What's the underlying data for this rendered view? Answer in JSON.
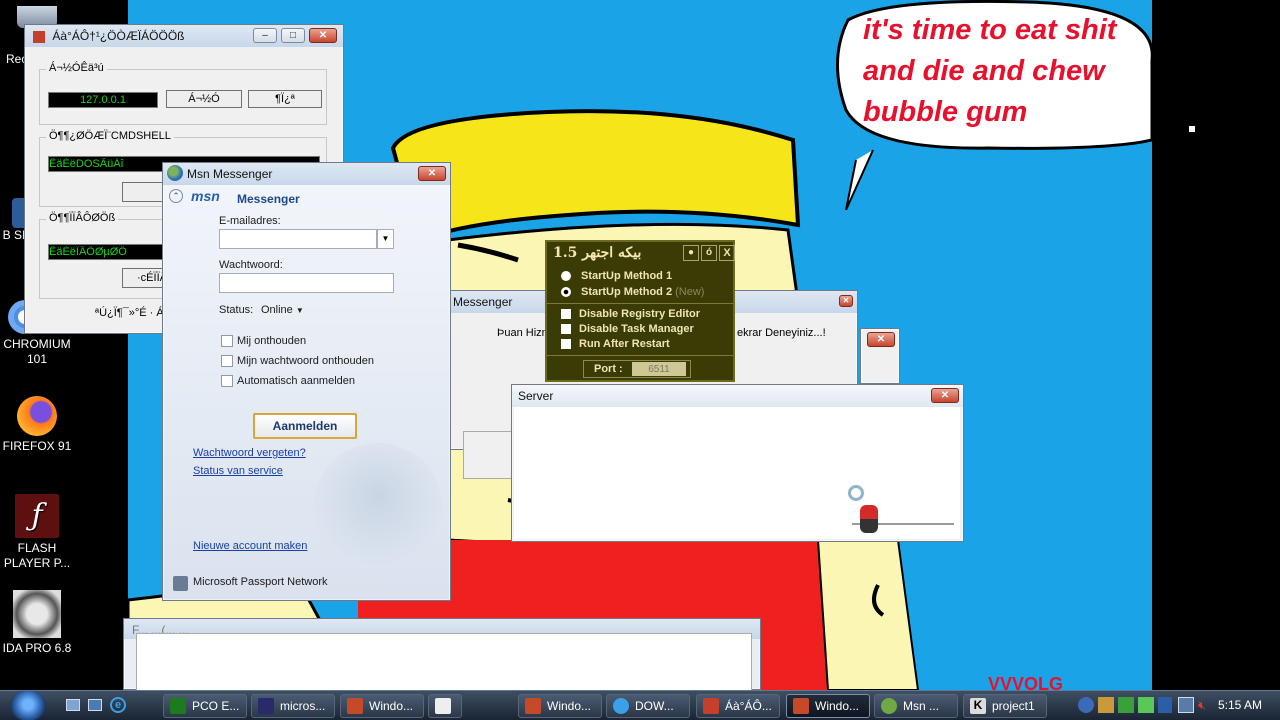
{
  "desktop": {
    "icons": [
      {
        "label": "Rec",
        "top": 0
      },
      {
        "label": "B SIM",
        "top": 0
      },
      {
        "label": "CHROMIUM 101",
        "top": 0
      },
      {
        "label": "FIREFOX 91",
        "top": 0
      },
      {
        "label": "FLASH PLAYER P...",
        "top": 0
      },
      {
        "label": "IDA PRO 6.8",
        "top": 0
      }
    ],
    "speech_bubble": [
      "it's time to eat shit",
      "and die and chew",
      "bubble gum"
    ]
  },
  "tool_window": {
    "title": "Áà°ÁÔ†¹¿ÖÒÆÏÁÖÖÖß",
    "group1_label": "Á¬½ÓÊä³ú",
    "ip_value": "127.0.0.1",
    "connect_button": "Á¬½Ó",
    "other_button": "¶Ï¿ª",
    "group2_label": "Ö¶¶¿ØÖÆÏ¨CMDSHELL",
    "cmd_value": "ÊäÈëDOSÃüÁî",
    "group3_label": "Ö¶¶ÏÏÂÔØÖß",
    "file_value": "ÊäÈëÏÂÔØµØÖ",
    "button3": "·cÉÏÏÂ",
    "footer": "ªÚ¿Ï¶¯»°É · Á"
  },
  "msn": {
    "title": "Msn Messenger",
    "brand": "msn",
    "brand_suffix": "Messenger",
    "email_label": "E-mailadres:",
    "password_label": "Wachtwoord:",
    "status_label": "Status:",
    "status_value": "Online",
    "options": [
      "Mij onthouden",
      "Mijn wachtwoord onthouden",
      "Automatisch aanmelden"
    ],
    "signin_button": "Aanmelden",
    "forgot_link": "Wachtwoord vergeten?",
    "service_link": "Status van service",
    "new_account_link": "Nieuwe account maken",
    "passport_label": "Microsoft Passport Network"
  },
  "messenger_dialog": {
    "title": "Messenger",
    "text_left": "Þuan Hizm",
    "text_right": "ekrar Deneyiniz...!"
  },
  "olive_panel": {
    "title": "1.5 بیکه اجتهر",
    "min_button": "●",
    "lock_button": "ó",
    "close_button": "X",
    "methods": [
      {
        "label": "StartUp Method",
        "num": "1",
        "extra": ""
      },
      {
        "label": "StartUp Method",
        "num": "2",
        "extra": "(New)"
      }
    ],
    "options": [
      "Disable Registry Editor",
      "Disable Task Manager",
      "Run After Restart"
    ],
    "port_label": "Port :",
    "port_value": "6511"
  },
  "server_window": {
    "title": "Server"
  },
  "bottom_window": {
    "title": "F... ...(... ..."
  },
  "taskbar": {
    "items": [
      "PCO E...",
      "micros...",
      "Windo...",
      "",
      "Windo...",
      "DOW...",
      "Áà°ÁÔ...",
      "Windo...",
      "Msn ...",
      "project1"
    ],
    "clock": "5:15 AM"
  },
  "colors": {
    "wallpaper": "#1aa3e6",
    "hat": "#f6e619",
    "skin": "#fbf6b4",
    "shirt": "#ee2020",
    "olive": "#3b3b05",
    "bubble_text": "#e8112d"
  }
}
